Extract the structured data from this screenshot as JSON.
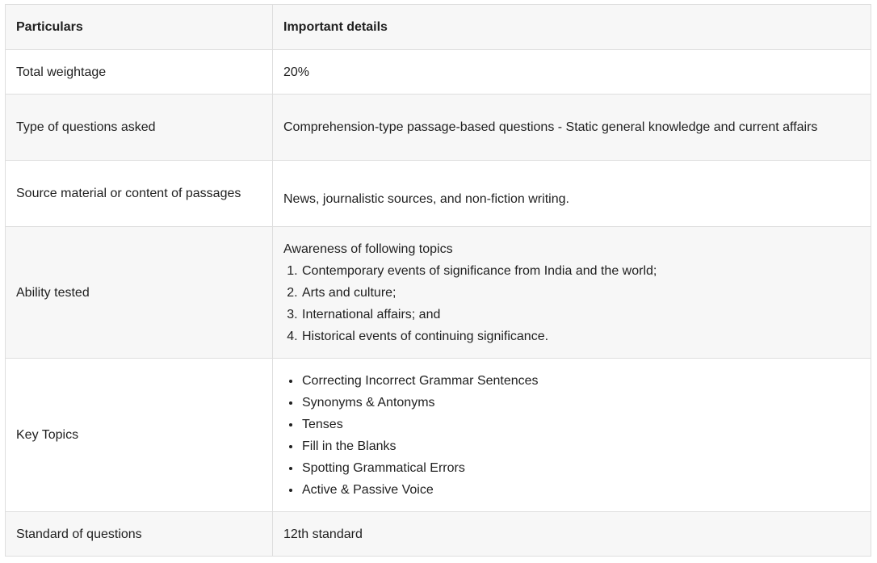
{
  "table": {
    "header": {
      "col1": "Particulars",
      "col2": "Important details"
    },
    "rows": [
      {
        "label": "Total weightage",
        "value": "20%"
      },
      {
        "label": "Type of questions asked",
        "value": "Comprehension-type passage-based questions - Static general knowledge and current affairs"
      },
      {
        "label": "Source material or content of passages",
        "value": "News, journalistic sources, and non-fiction writing."
      },
      {
        "label": "Ability tested",
        "intro": "Awareness of following topics",
        "items": [
          "Contemporary events of significance from India and the world;",
          "Arts and culture;",
          "International affairs; and",
          "Historical events of continuing significance."
        ]
      },
      {
        "label": "Key Topics",
        "items": [
          "Correcting Incorrect Grammar Sentences",
          "Synonyms & Antonyms",
          "Tenses",
          "Fill in the Blanks",
          "Spotting Grammatical Errors",
          "Active & Passive Voice"
        ]
      },
      {
        "label": "Standard of questions",
        "value": "12th standard"
      }
    ]
  }
}
